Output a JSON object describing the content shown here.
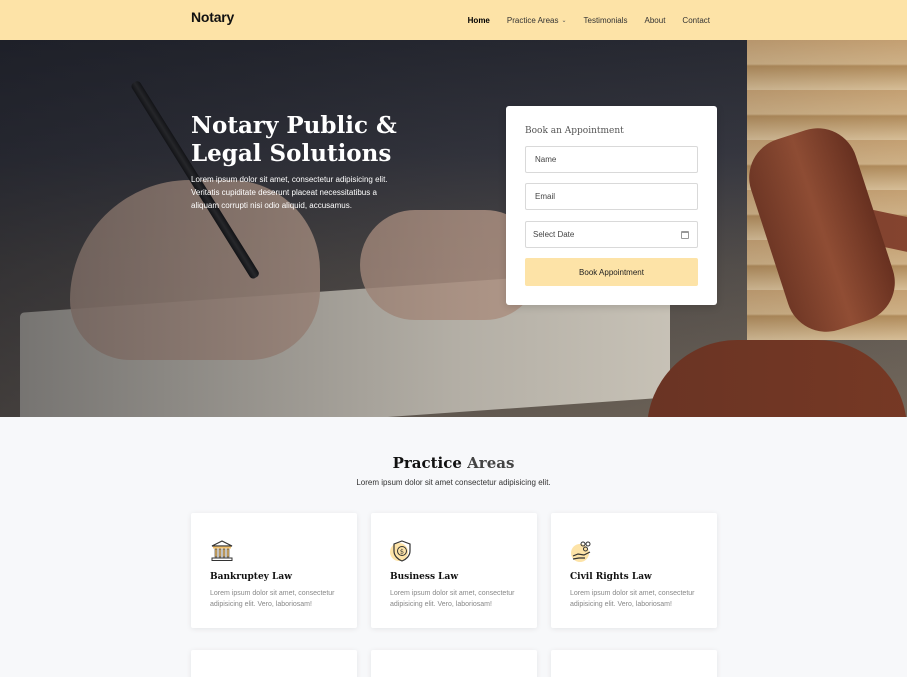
{
  "brand": "Notary",
  "nav": {
    "items": [
      {
        "label": "Home",
        "active": true
      },
      {
        "label": "Practice Areas",
        "dropdown": true
      },
      {
        "label": "Testimonials"
      },
      {
        "label": "About"
      },
      {
        "label": "Contact"
      }
    ],
    "caret": "⌄"
  },
  "hero": {
    "title_bold": "Notary Public &",
    "title_light": "Legal Solutions",
    "text": "Lorem ipsum dolor sit amet, consectetur adipisicing elit. Veritatis cupiditate deserunt placeat necessitatibus a aliquam corrupti nisi odio aliquid, accusamus."
  },
  "booking": {
    "title": "Book an Appointment",
    "name_placeholder": "Name",
    "email_placeholder": "Email",
    "date_placeholder": "Select Date",
    "button": "Book Appointment"
  },
  "practice": {
    "title_bold": "Practice",
    "title_light": "Areas",
    "subtitle": "Lorem ipsum dolor sit amet consectetur adipisicing elit.",
    "cards": [
      {
        "title": "Bankruptey Law",
        "icon": "bank-icon",
        "text": "Lorem ipsum dolor sit amet, consectetur adipisicing elit. Vero, laboriosam!"
      },
      {
        "title": "Business Law",
        "icon": "shield-dollar-icon",
        "text": "Lorem ipsum dolor sit amet, consectetur adipisicing elit. Vero, laboriosam!"
      },
      {
        "title": "Civil Rights Law",
        "icon": "people-hand-icon",
        "text": "Lorem ipsum dolor sit amet, consectetur adipisicing elit. Vero, laboriosam!"
      }
    ]
  },
  "colors": {
    "accent": "#fde3a7",
    "icon_accent": "#f5c26b",
    "text_dark": "#111111"
  }
}
